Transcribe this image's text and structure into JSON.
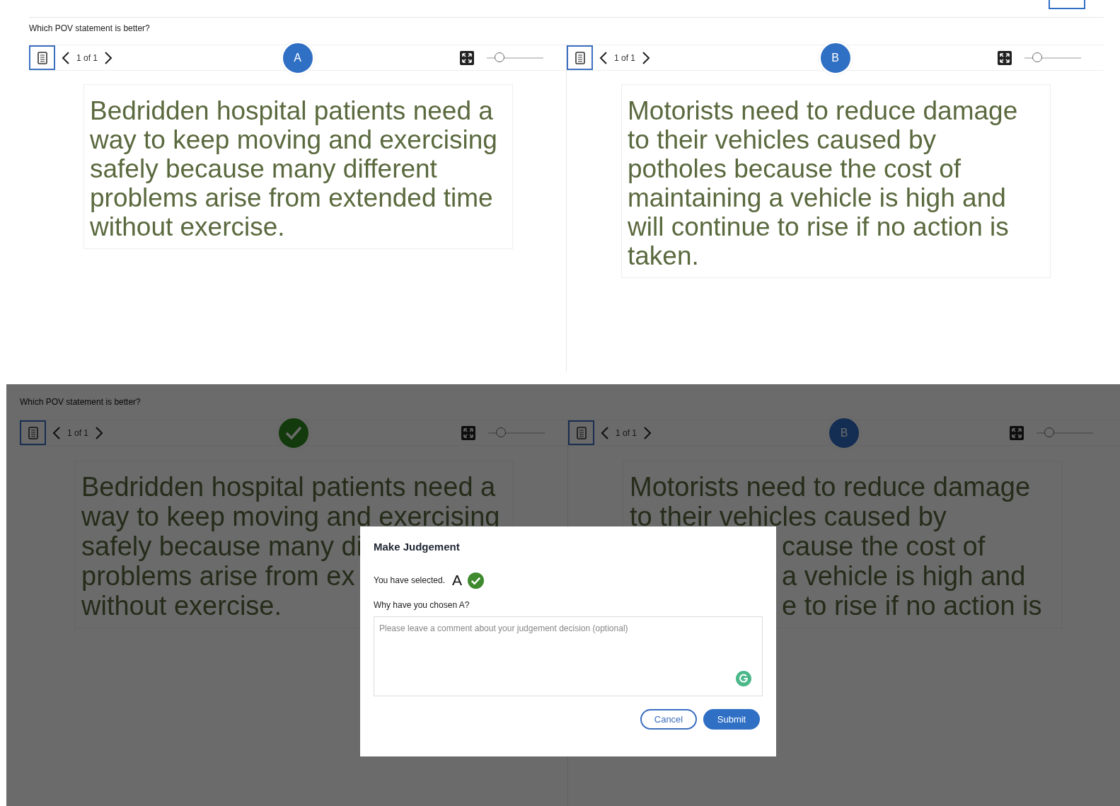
{
  "screens": [
    {
      "question": "Which POV statement is better?",
      "dimmed": false,
      "panels": [
        {
          "pager": "1 of 1",
          "badge": {
            "kind": "letter",
            "label": "A"
          },
          "zoom": {
            "level": 0.22
          },
          "statement_lines": [
            {
              "text": "Bedridden hospital patients need a",
              "cut": false
            },
            {
              "text": "way to keep moving and exercising",
              "cut": false
            },
            {
              "text": "safely because many different",
              "cut": false
            },
            {
              "text": "problems arise from extended time",
              "cut": false
            },
            {
              "text": "without exercise.",
              "cut": false
            }
          ]
        },
        {
          "pager": "1 of 1",
          "badge": {
            "kind": "letter",
            "label": "B"
          },
          "zoom": {
            "level": 0.22
          },
          "statement_lines": [
            {
              "text": "Motorists need to reduce damage",
              "cut": false
            },
            {
              "text": "to their vehicles caused by",
              "cut": false
            },
            {
              "text": "potholes because the cost of",
              "cut": false
            },
            {
              "text": "maintaining a vehicle is high and",
              "cut": false
            },
            {
              "text": "will continue to rise if no action is",
              "cut": false
            },
            {
              "text": "taken.",
              "cut": false
            }
          ]
        }
      ]
    },
    {
      "question": "Which POV statement is better?",
      "dimmed": true,
      "panels": [
        {
          "pager": "1 of 1",
          "badge": {
            "kind": "check"
          },
          "zoom": {
            "level": 0.22
          },
          "statement_lines": [
            {
              "text": "Bedridden hospital patients need a",
              "cut": false
            },
            {
              "text": "way to keep moving and exercising",
              "cut": false
            },
            {
              "text": "safely because many di",
              "cut": false
            },
            {
              "text": "problems arise from ex",
              "cut": false
            },
            {
              "text": "without exercise.",
              "cut": false
            }
          ]
        },
        {
          "pager": "1 of 1",
          "badge": {
            "kind": "letter",
            "label": "B"
          },
          "zoom": {
            "level": 0.22
          },
          "statement_lines": [
            {
              "text": "Motorists need to reduce damage",
              "cut": false
            },
            {
              "text": "to their vehicles caused by",
              "cut": false
            },
            {
              "text": "cause the cost of",
              "cut": true
            },
            {
              "text": "a vehicle is high and",
              "cut": true
            },
            {
              "text": "e to rise if no action is",
              "cut": true
            }
          ]
        }
      ],
      "dialog": {
        "title": "Make Judgement",
        "selected_text": "You have selected.",
        "selected_choice": "A",
        "question": "Why have you chosen A?",
        "comment": {
          "placeholder": "Please leave a comment about your judgement decision (optional)"
        },
        "buttons": [
          {
            "label": "Cancel",
            "kind": "secondary"
          },
          {
            "label": "Submit",
            "kind": "primary"
          }
        ]
      }
    }
  ]
}
